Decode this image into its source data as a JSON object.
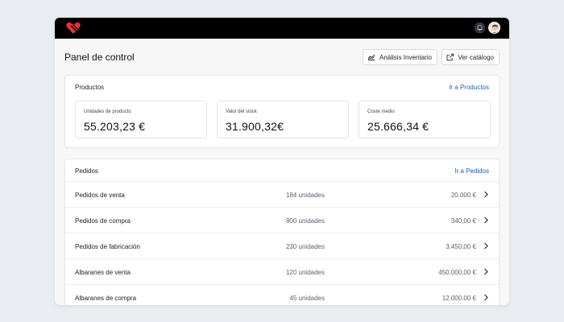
{
  "header": {
    "title": "Panel de control",
    "analysis_button": "Análisis Inventario",
    "catalog_button": "Ver catálogo"
  },
  "topbar": {
    "logo_icon": "heart-logo-icon",
    "bell_icon": "bell-icon",
    "avatar": "user-avatar",
    "brand_color": "#e8333a"
  },
  "products": {
    "title": "Productos",
    "link": "Ir a Productos",
    "metrics": [
      {
        "label": "Unidades de producto",
        "value": "55.203,23 €"
      },
      {
        "label": "Valor del stock",
        "value": "31.900,32€"
      },
      {
        "label": "Coste medio",
        "value": "25.666,34 €"
      }
    ]
  },
  "orders": {
    "title": "Pedidos",
    "link": "Ir a Pedidos",
    "rows": [
      {
        "name": "Pedidos de venta",
        "quantity": "184 unidades",
        "amount": "20.000 €"
      },
      {
        "name": "Pedidos de compra",
        "quantity": "800 unidades",
        "amount": "340,00 €"
      },
      {
        "name": "Pedidos de fabricación",
        "quantity": "230 unidades",
        "amount": "3.450,00 €"
      },
      {
        "name": "Albaranes de venta",
        "quantity": "120 unidades",
        "amount": "450.000,00 €"
      },
      {
        "name": "Albaranes de compra",
        "quantity": "45 unidades",
        "amount": "12.000,00 €"
      }
    ]
  },
  "colors": {
    "link": "#1f5fbf",
    "topbar": "#000000",
    "background": "#e9ecf1"
  }
}
